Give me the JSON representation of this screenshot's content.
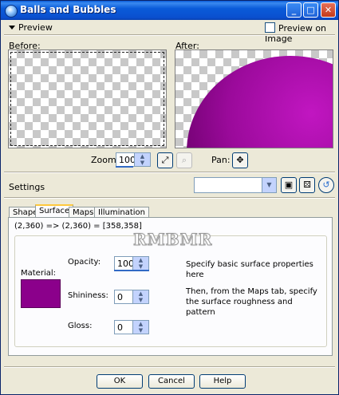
{
  "window": {
    "title": "Balls and Bubbles",
    "controls": {
      "minimize": "_",
      "maximize": "□",
      "close": "✕"
    }
  },
  "preview": {
    "toggle_label": "Preview",
    "preview_on_image_label": "Preview on Image",
    "before_label": "Before:",
    "after_label": "After:",
    "zoom_label": "Zoom:",
    "zoom_value": "100",
    "pan_label": "Pan:"
  },
  "settings": {
    "label": "Settings",
    "preset_value": ""
  },
  "tabs": [
    {
      "label": "Shape",
      "active": false
    },
    {
      "label": "Surface",
      "active": true
    },
    {
      "label": "Maps",
      "active": false
    },
    {
      "label": "Illumination",
      "active": false
    }
  ],
  "surface": {
    "coords_text": "(2,360) => (2,360) = [358,358]",
    "watermark_text": "RMBMR",
    "material_label": "Material:",
    "material_color": "#8b008b",
    "opacity_label": "Opacity:",
    "opacity_value": "100",
    "shininess_label": "Shininess:",
    "shininess_value": "0",
    "gloss_label": "Gloss:",
    "gloss_value": "0",
    "desc1": "Specify basic surface properties here",
    "desc2": "Then, from the Maps tab, specify the surface roughness and pattern"
  },
  "buttons": {
    "ok": "OK",
    "cancel": "Cancel",
    "help": "Help"
  },
  "icons": [
    "window-app-icon",
    "zoom-fit-icon",
    "zoom-icon",
    "pan-icon",
    "save-preset-icon",
    "randomize-icon",
    "reset-icon"
  ]
}
